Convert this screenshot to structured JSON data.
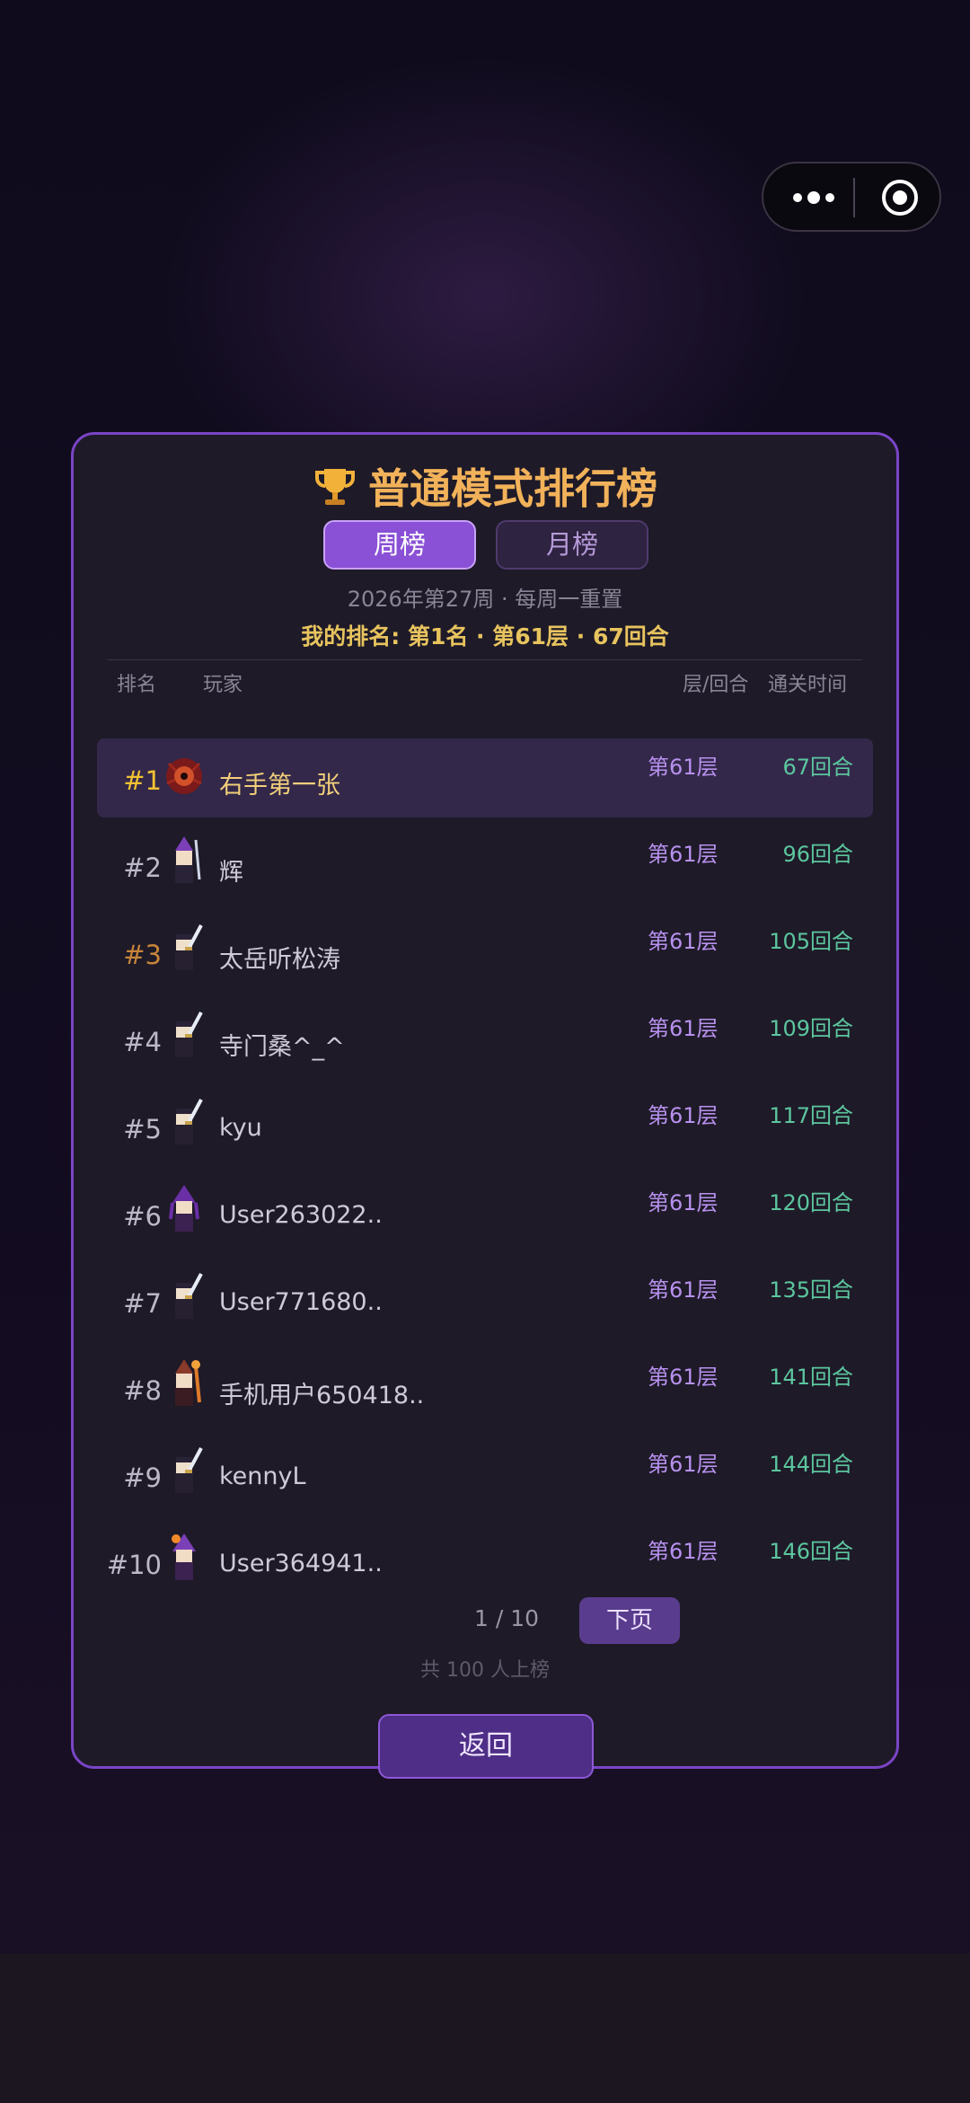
{
  "capsule": {
    "more_icon": "more-dots-icon",
    "target_icon": "target-icon"
  },
  "leaderboard": {
    "title": "普通模式排行榜",
    "tabs": [
      {
        "label": "周榜",
        "active": true
      },
      {
        "label": "月榜",
        "active": false
      }
    ],
    "week_info": "2026年第27周 · 每周一重置",
    "my_rank": "我的排名: 第1名 · 第61层 · 67回合",
    "columns": {
      "rank": "排名",
      "player": "玩家",
      "layer_turn": "层/回合",
      "clear_time": "通关时间"
    },
    "rows": [
      {
        "rank": "#1",
        "name": "右手第一张",
        "layer": "第61层",
        "turns": "67回合",
        "avatar": "demon-avatar-icon"
      },
      {
        "rank": "#2",
        "name": "辉",
        "layer": "第61层",
        "turns": "96回合",
        "avatar": "mage-avatar-icon"
      },
      {
        "rank": "#3",
        "name": "太岳听松涛",
        "layer": "第61层",
        "turns": "105回合",
        "avatar": "swordsman-avatar-icon"
      },
      {
        "rank": "#4",
        "name": "寺门桑^_^",
        "layer": "第61层",
        "turns": "109回合",
        "avatar": "swordsman-avatar-icon"
      },
      {
        "rank": "#5",
        "name": "kyu",
        "layer": "第61层",
        "turns": "117回合",
        "avatar": "swordsman-avatar-icon"
      },
      {
        "rank": "#6",
        "name": "User263022..",
        "layer": "第61层",
        "turns": "120回合",
        "avatar": "witch-avatar-icon"
      },
      {
        "rank": "#7",
        "name": "User771680..",
        "layer": "第61层",
        "turns": "135回合",
        "avatar": "swordsman-avatar-icon"
      },
      {
        "rank": "#8",
        "name": "手机用户650418..",
        "layer": "第61层",
        "turns": "141回合",
        "avatar": "fire-mage-avatar-icon"
      },
      {
        "rank": "#9",
        "name": "kennyL",
        "layer": "第61层",
        "turns": "144回合",
        "avatar": "swordsman-avatar-icon"
      },
      {
        "rank": "#10",
        "name": "User364941..",
        "layer": "第61层",
        "turns": "146回合",
        "avatar": "fire-witch-avatar-icon"
      }
    ],
    "pagination": {
      "page": "1 / 10",
      "next_label": "下页"
    },
    "total": "共 100 人上榜",
    "back_label": "返回"
  },
  "colors": {
    "accent": "#8a50d6",
    "gold": "#f2b25a",
    "turns": "#5cc69e",
    "layer": "#b891ee",
    "border": "#7a45c6"
  }
}
